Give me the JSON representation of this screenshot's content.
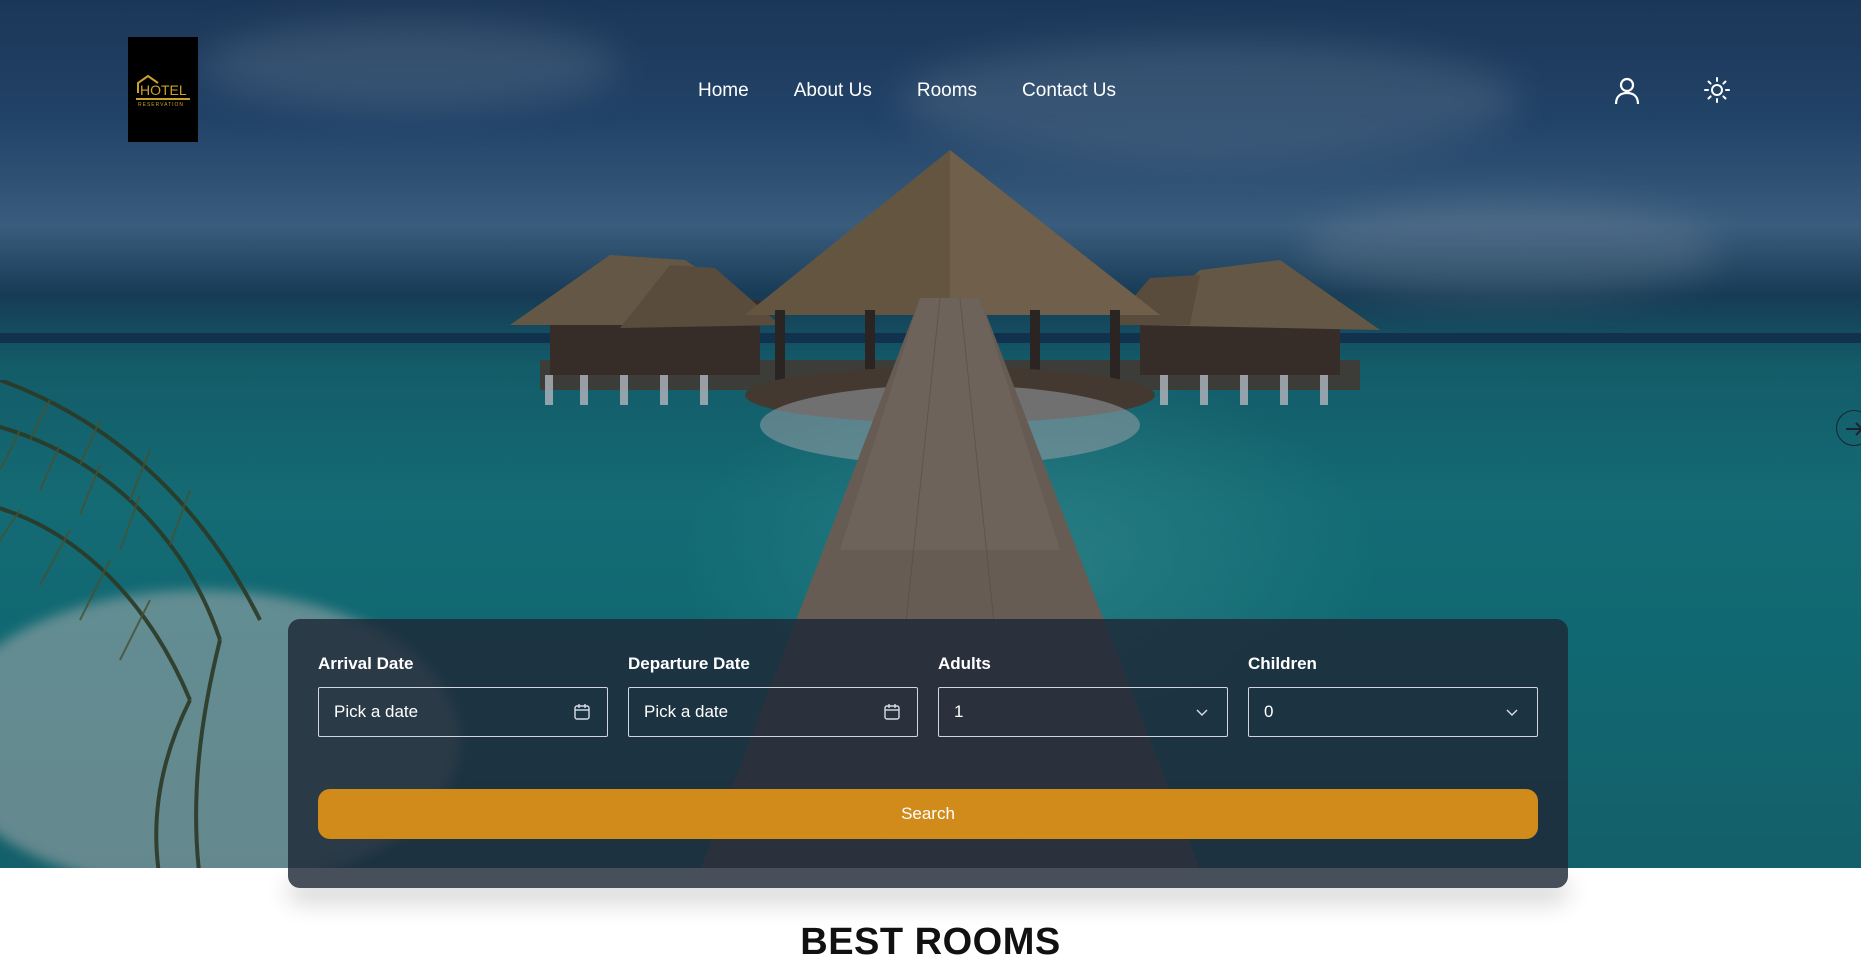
{
  "brand": {
    "logo_text": "HOTEL",
    "logo_subtext": "RESERVATION",
    "logo_color": "#c9a227"
  },
  "nav": {
    "items": [
      {
        "label": "Home"
      },
      {
        "label": "About Us"
      },
      {
        "label": "Rooms"
      },
      {
        "label": "Contact Us"
      }
    ]
  },
  "header_icons": {
    "user": "user-icon",
    "theme": "sun-icon"
  },
  "booking": {
    "arrival": {
      "label": "Arrival Date",
      "placeholder": "Pick a date",
      "icon": "calendar-icon"
    },
    "departure": {
      "label": "Departure Date",
      "placeholder": "Pick a date",
      "icon": "calendar-icon"
    },
    "adults": {
      "label": "Adults",
      "value": "1",
      "icon": "chevron-down-icon"
    },
    "children": {
      "label": "Children",
      "value": "0",
      "icon": "chevron-down-icon"
    },
    "search_label": "Search",
    "accent_color": "#d18b1a"
  },
  "carousel": {
    "next_icon": "arrow-right-icon"
  },
  "section": {
    "title": "BEST ROOMS"
  }
}
